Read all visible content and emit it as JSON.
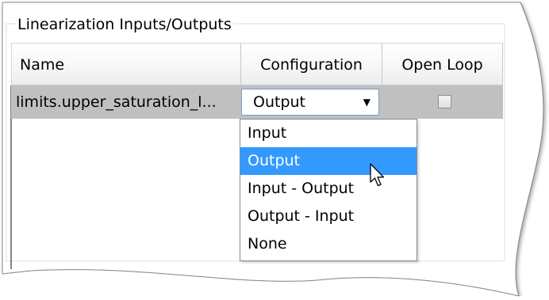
{
  "group": {
    "title": "Linearization Inputs/Outputs"
  },
  "table": {
    "columns": [
      {
        "label": "Name"
      },
      {
        "label": "Configuration"
      },
      {
        "label": "Open Loop"
      }
    ],
    "rows": [
      {
        "name": "limits.upper_saturation_l...",
        "configuration": "Output",
        "open_loop": false
      }
    ]
  },
  "dropdown": {
    "options": [
      "Input",
      "Output",
      "Input - Output",
      "Output - Input",
      "None"
    ],
    "highlighted": "Output"
  },
  "icons": {
    "combo_arrow": "chevron-down-icon",
    "cursor": "mouse-pointer-icon",
    "checkbox": "checkbox-unchecked-icon"
  },
  "colors": {
    "selection": "#3399ff",
    "row_highlight": "#c0c0c0",
    "combo_border": "#7a9cc6"
  }
}
